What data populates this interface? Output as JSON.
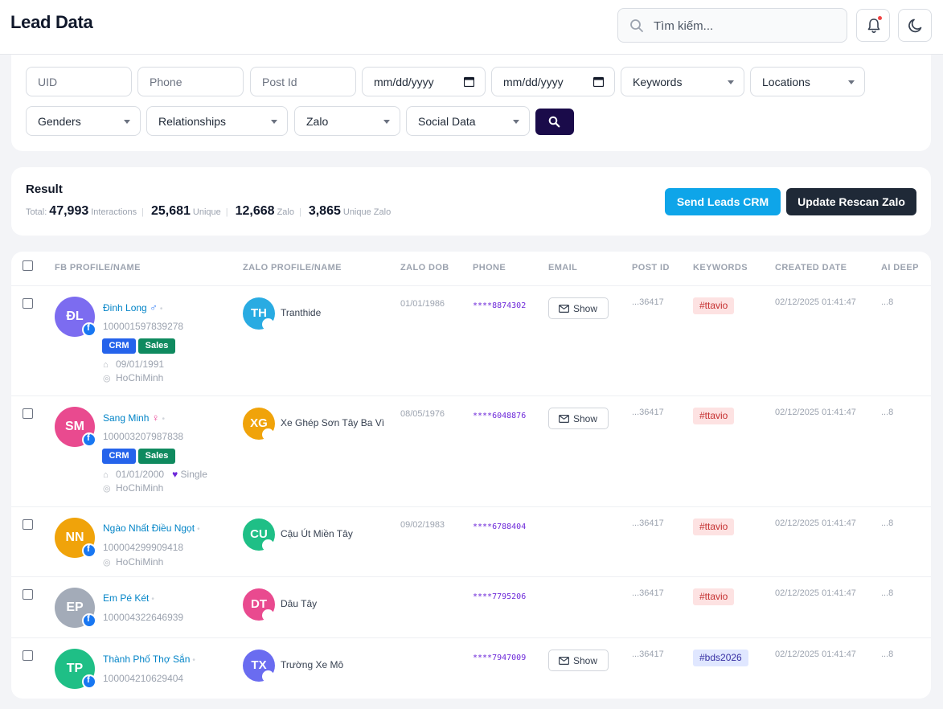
{
  "header": {
    "title": "Lead Data",
    "search_placeholder": "Tìm kiếm..."
  },
  "filters": {
    "uid_placeholder": "UID",
    "phone_placeholder": "Phone",
    "postid_placeholder": "Post Id",
    "date_from_placeholder": "mm/dd/yyyy",
    "date_to_placeholder": "mm/dd/yyyy",
    "keywords": "Keywords",
    "locations": "Locations",
    "genders": "Genders",
    "relationships": "Relationships",
    "zalo": "Zalo",
    "social_data": "Social Data"
  },
  "result": {
    "title": "Result",
    "total_label": "Total:",
    "interactions_value": "47,993",
    "interactions_label": "Interactions",
    "unique_value": "25,681",
    "unique_label": "Unique",
    "zalo_value": "12,668",
    "zalo_label": "Zalo",
    "unique_zalo_value": "3,865",
    "unique_zalo_label": "Unique Zalo",
    "send_crm_label": "Send Leads CRM",
    "rescan_label": "Update Rescan Zalo"
  },
  "table": {
    "columns": [
      "FB PROFILE/NAME",
      "ZALO PROFILE/NAME",
      "ZALO DOB",
      "PHONE",
      "EMAIL",
      "POST ID",
      "KEYWORDS",
      "CREATED DATE",
      "AI DEEP"
    ],
    "show_label": "Show",
    "tag_crm": "CRM",
    "tag_sales": "Sales",
    "rows": [
      {
        "initials": "ĐL",
        "avatar_color": "#7c6cf0",
        "name": "Đinh Long",
        "gender": "♂",
        "uid": "100001597839278",
        "tags": true,
        "dob": "09/01/1991",
        "relationship": "",
        "location": "HoChiMinh",
        "z_initials": "TH",
        "z_color": "#29abe2",
        "z_name": "Tranthide",
        "zalo_dob": "01/01/1986",
        "phone": "****8874302",
        "email": true,
        "post_id": "...36417",
        "keyword": "#ttavio",
        "kw_style": "red",
        "created": "02/12/2025 01:41:47",
        "ai": "...8"
      },
      {
        "initials": "SM",
        "avatar_color": "#e94a8f",
        "name": "Sang Minh",
        "gender": "♀",
        "uid": "100003207987838",
        "tags": true,
        "dob": "01/01/2000",
        "relationship": "Single",
        "location": "HoChiMinh",
        "z_initials": "XG",
        "z_color": "#f0a30a",
        "z_name": "Xe Ghép Sơn Tây Ba Vì",
        "zalo_dob": "08/05/1976",
        "phone": "****6048876",
        "email": true,
        "post_id": "...36417",
        "keyword": "#ttavio",
        "kw_style": "red",
        "created": "02/12/2025 01:41:47",
        "ai": "...8"
      },
      {
        "initials": "NN",
        "avatar_color": "#f0a30a",
        "name": "Ngào Nhất Điều Ngọt",
        "gender": "",
        "uid": "100004299909418",
        "tags": false,
        "dob": "",
        "relationship": "",
        "location": "HoChiMinh",
        "z_initials": "CU",
        "z_color": "#1fbf86",
        "z_name": "Cậu Út Miền Tây",
        "zalo_dob": "09/02/1983",
        "phone": "****6788404",
        "email": false,
        "post_id": "...36417",
        "keyword": "#ttavio",
        "kw_style": "red",
        "created": "02/12/2025 01:41:47",
        "ai": "...8"
      },
      {
        "initials": "EP",
        "avatar_color": "#a3abb8",
        "name": "Em Pé Két",
        "gender": "",
        "uid": "100004322646939",
        "tags": false,
        "dob": "",
        "relationship": "",
        "location": "",
        "z_initials": "DT",
        "z_color": "#e94a8f",
        "z_name": "Dâu Tây",
        "zalo_dob": "",
        "phone": "****7795206",
        "email": false,
        "post_id": "...36417",
        "keyword": "#ttavio",
        "kw_style": "red",
        "created": "02/12/2025 01:41:47",
        "ai": "...8"
      },
      {
        "initials": "TP",
        "avatar_color": "#1fbf86",
        "name": "Thành Phố Thợ Sắn",
        "gender": "",
        "uid": "100004210629404",
        "tags": false,
        "dob": "",
        "relationship": "",
        "location": "",
        "z_initials": "TX",
        "z_color": "#6a6cf0",
        "z_name": "Trường Xe Mô",
        "zalo_dob": "",
        "phone": "****7947009",
        "email": true,
        "post_id": "...36417",
        "keyword": "#bds2026",
        "kw_style": "blue",
        "created": "02/12/2025 01:41:47",
        "ai": "...8"
      }
    ]
  }
}
